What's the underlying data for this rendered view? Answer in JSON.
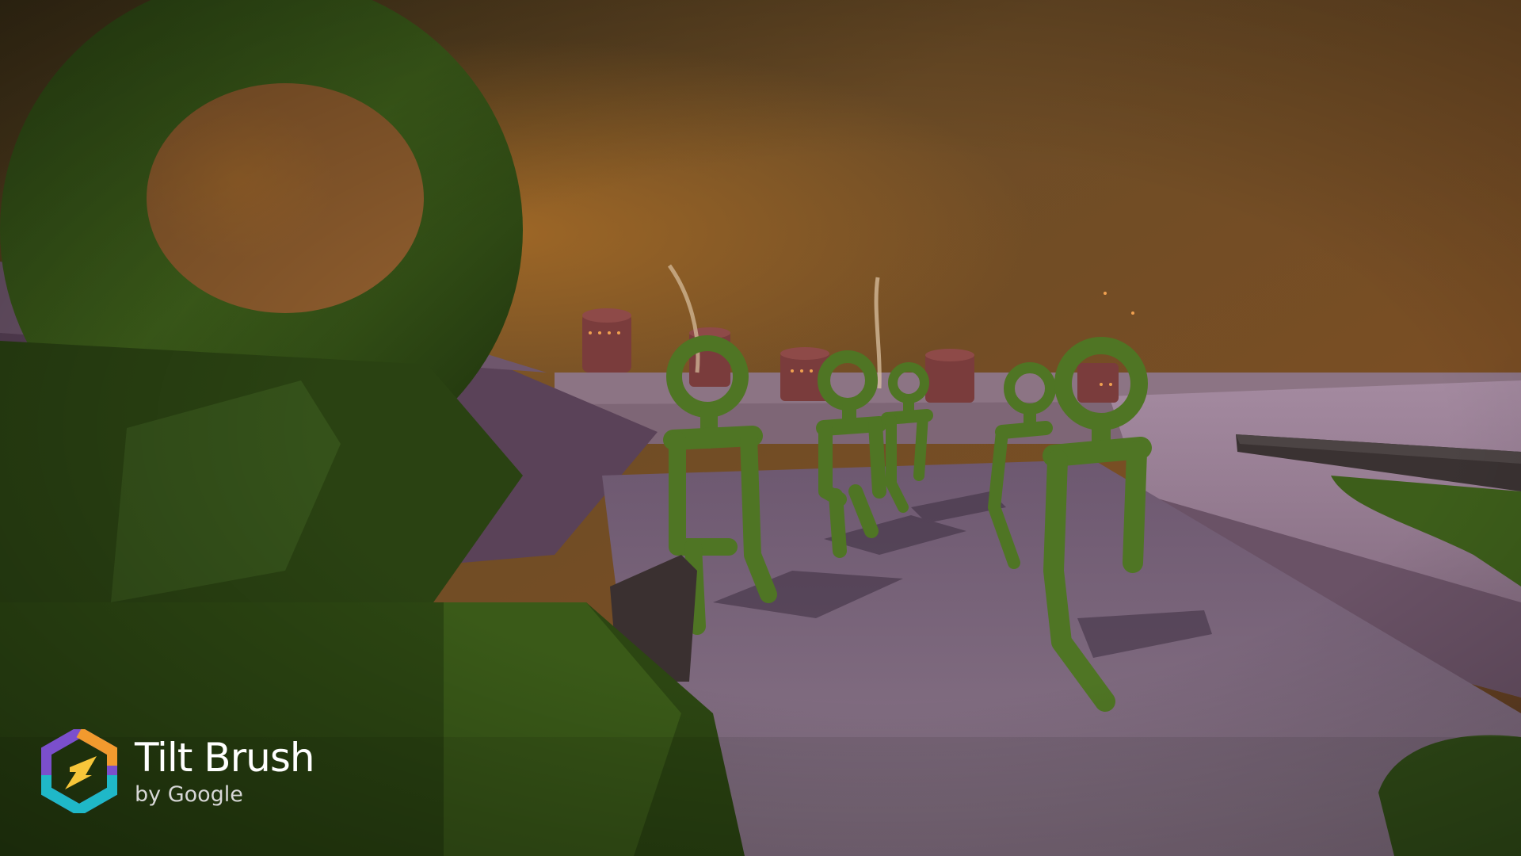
{
  "app": {
    "brand_title": "Tilt Brush",
    "brand_subtitle": "by Google"
  },
  "scene": {
    "sky_color": "#6a4a2c",
    "sky_glow_color": "#9c6a28",
    "ground_color": "#7a6478",
    "figure_color": "#4a6e22",
    "tower_color": "#7a3c3c"
  },
  "icons": {
    "logo": "tilt-brush-hexagon-logo"
  }
}
